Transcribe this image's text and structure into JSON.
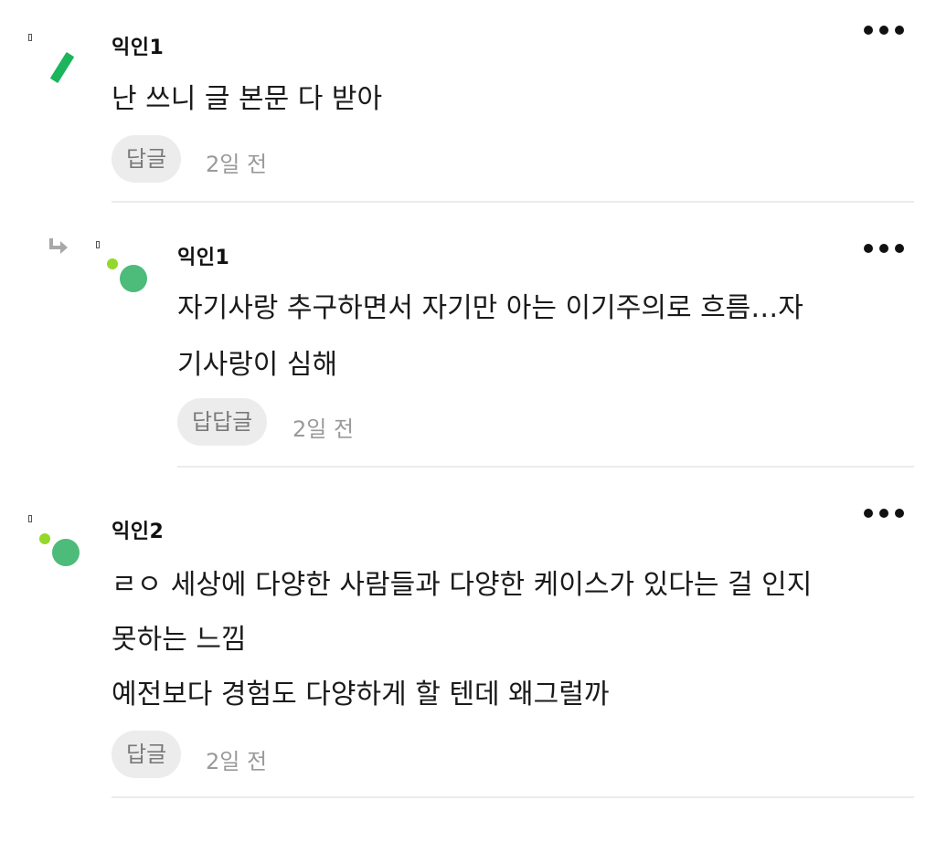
{
  "comments": [
    {
      "author": "익인1",
      "lines": [
        "난 쓰니 글 본문 다 받아"
      ],
      "reply_label": "답글",
      "time": "2일 전"
    },
    {
      "author": "익인1",
      "lines": [
        "자기사랑 추구하면서 자기만 아는 이기주의로 흐름…자",
        "기사랑이 심해"
      ],
      "reply_label": "답답글",
      "time": "2일 전"
    },
    {
      "author": "익인2",
      "lines": [
        "ㄹㅇ 세상에 다양한 사람들과 다양한 케이스가 있다는 걸 인지",
        "못하는 느낌",
        "예전보다 경험도 다양하게 할 텐데 왜그럴까"
      ],
      "reply_label": "답글",
      "time": "2일 전"
    }
  ],
  "colors": {
    "avatar_green": "#1bb55c",
    "avatar_lime": "#93d82a",
    "avatar_mint": "#4dbb7a"
  },
  "icons": [
    "more-dots-icon",
    "reply-arrow-icon"
  ]
}
